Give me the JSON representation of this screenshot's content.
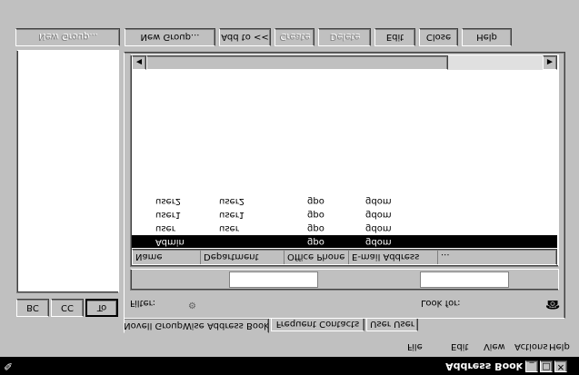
{
  "window": {
    "title": "Address Book"
  },
  "menu": [
    "File",
    "Edit",
    "View",
    "Actions",
    "Help"
  ],
  "tabs": [
    "Novell GroupWise Address Book",
    "Frequent Contacts",
    "User User"
  ],
  "search": {
    "lookup_label": "Look for:",
    "lookup_value": "",
    "filter_label": "Filter:",
    "right_field_value": "",
    "left_field_value": ""
  },
  "list": {
    "columns": [
      "Name",
      "Department",
      "Office Phone",
      "E-mail Address",
      "..."
    ],
    "rows": [
      {
        "name": "Admin",
        "domain": "gdom",
        "po": "gpo",
        "email": "",
        "selected": true
      },
      {
        "name": "user",
        "domain": "gdom",
        "po": "gpo",
        "email": "user",
        "selected": false
      },
      {
        "name": "user1",
        "domain": "gdom",
        "po": "gpo",
        "email": "user1",
        "selected": false
      },
      {
        "name": "user2",
        "domain": "gdom",
        "po": "gpo",
        "email": "user2",
        "selected": false
      }
    ]
  },
  "toolbar": [
    "Help",
    "Close",
    "Edit",
    "Delete",
    "Create",
    "Add to <<",
    "New Group..."
  ],
  "recipient_buttons": {
    "to": "To",
    "cc": "CC",
    "bc": "BC"
  }
}
